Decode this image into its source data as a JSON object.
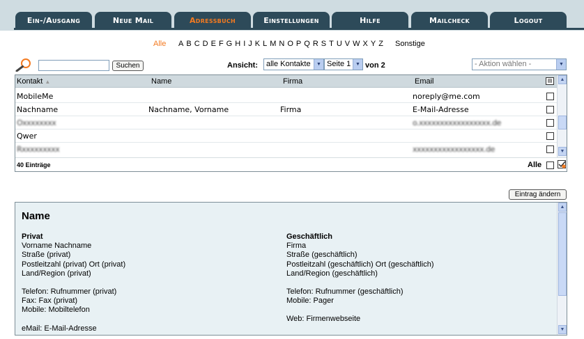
{
  "tabs": [
    {
      "label": "Ein-/Ausgang",
      "active": false
    },
    {
      "label": "Neue Mail",
      "active": false
    },
    {
      "label": "Adressbuch",
      "active": true
    },
    {
      "label": "Einstellungen",
      "active": false
    },
    {
      "label": "Hilfe",
      "active": false
    },
    {
      "label": "Mailcheck",
      "active": false
    },
    {
      "label": "Logout",
      "active": false
    }
  ],
  "alphabet": {
    "all": "Alle",
    "letters": [
      "A",
      "B",
      "C",
      "D",
      "E",
      "F",
      "G",
      "H",
      "I",
      "J",
      "K",
      "L",
      "M",
      "N",
      "O",
      "P",
      "Q",
      "R",
      "S",
      "T",
      "U",
      "V",
      "W",
      "X",
      "Y",
      "Z"
    ],
    "other": "Sonstige"
  },
  "search": {
    "input_value": "",
    "button": "Suchen",
    "view_label": "Ansicht:",
    "view_selected": "alle Kontakte",
    "page_selected": "Seite 1",
    "page_of": "von 2",
    "action_selected": "- Aktion wählen -"
  },
  "table": {
    "headers": {
      "contact": "Kontakt",
      "sort_indicator": "▲",
      "name": "Name",
      "company": "Firma",
      "email": "Email"
    },
    "rows": [
      {
        "contact": "MobileMe",
        "name": "",
        "company": "",
        "email": "noreply@me.com"
      },
      {
        "contact": "Nachname",
        "name": "Nachname, Vorname",
        "company": "Firma",
        "email": "E-Mail-Adresse"
      },
      {
        "contact": "Oxxxxxxxx",
        "name": "",
        "company": "",
        "email": "o.xxxxxxxxxxxxxxxxx.de"
      },
      {
        "contact": "Qwer",
        "name": "",
        "company": "",
        "email": ""
      },
      {
        "contact": "Rxxxxxxxxx",
        "name": "",
        "company": "",
        "email": "xxxxxxxxxxxxxxxxx.de"
      }
    ],
    "count": "40 Einträge",
    "select_all": "Alle"
  },
  "edit_button": "Eintrag ändern",
  "detail": {
    "title": "Name",
    "private": {
      "heading": "Privat",
      "lines": [
        "Vorname Nachname",
        "Straße (privat)",
        "Postleitzahl (privat) Ort (privat)",
        "Land/Region (privat)"
      ],
      "phone": "Telefon: Rufnummer (privat)",
      "fax": "Fax: Fax (privat)",
      "mobile": "Mobile: Mobiltelefon",
      "email": "eMail: E-Mail-Adresse"
    },
    "business": {
      "heading": "Geschäftlich",
      "lines": [
        "Firma",
        "Straße (geschäftlich)",
        "Postleitzahl (geschäftlich) Ort (geschäftlich)",
        "Land/Region (geschäftlich)"
      ],
      "phone": "Telefon: Rufnummer (geschäftlich)",
      "mobile": "Mobile: Pager",
      "web": "Web: Firmenwebseite"
    }
  },
  "colors": {
    "accent": "#f47a20",
    "tab_bg": "#2d4a59",
    "header_bg": "#cfdce1",
    "panel_bg": "#e8f1f4"
  }
}
